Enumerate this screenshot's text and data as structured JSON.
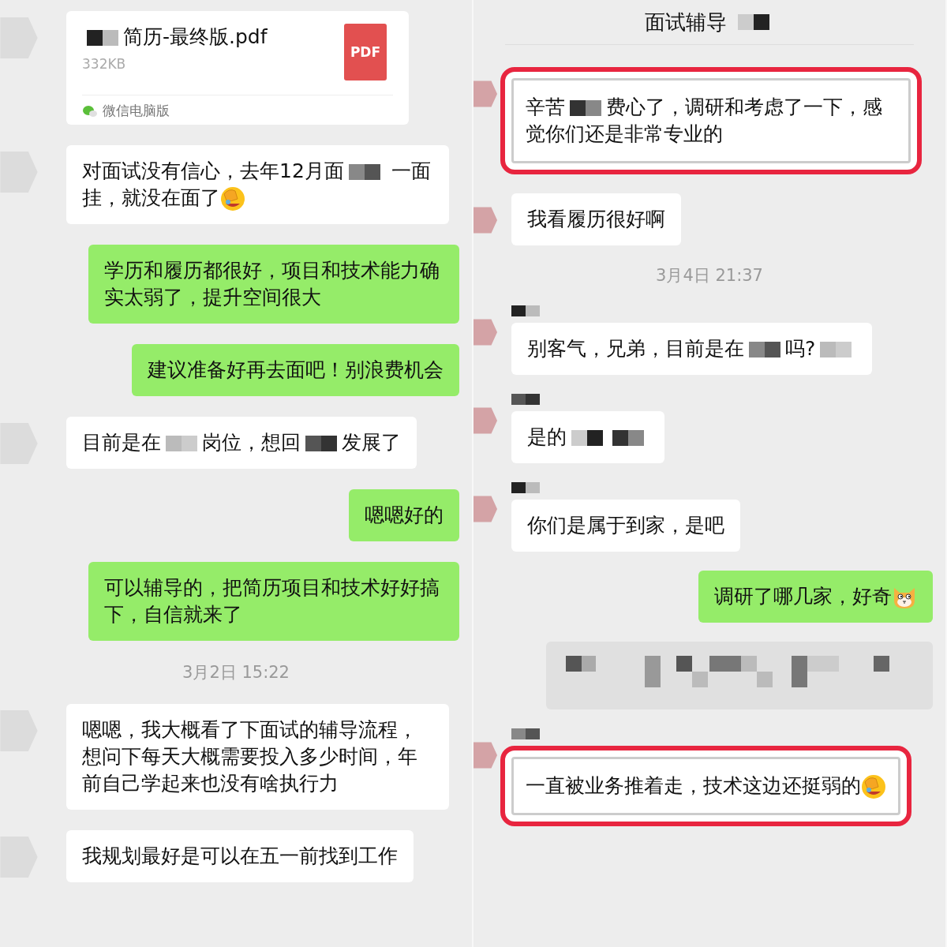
{
  "panels": [
    {
      "messages": [
        {
          "kind": "file",
          "filename": [
            {
              "kind": "mosaic"
            },
            {
              "kind": "text",
              "text": "简历-最终版.pdf"
            }
          ],
          "size": "332KB",
          "file_type": "PDF",
          "source": "微信电脑版"
        },
        {
          "kind": "received",
          "highlighted": false,
          "segments": [
            {
              "kind": "text",
              "text": "对面试没有信心，去年12月面"
            },
            {
              "kind": "mosaic"
            },
            {
              "kind": "text",
              "text": " 一面挂，就没在面了"
            },
            {
              "kind": "facepalm"
            }
          ]
        },
        {
          "kind": "sent",
          "segments": [
            {
              "kind": "text",
              "text": "学历和履历都很好，项目和技术能力确实太弱了，提升空间很大"
            }
          ]
        },
        {
          "kind": "sent",
          "segments": [
            {
              "kind": "text",
              "text": "建议准备好再去面吧！别浪费机会"
            }
          ]
        },
        {
          "kind": "received",
          "highlighted": false,
          "segments": [
            {
              "kind": "text",
              "text": "目前是在"
            },
            {
              "kind": "mosaic"
            },
            {
              "kind": "text",
              "text": "岗位，想回"
            },
            {
              "kind": "mosaic"
            },
            {
              "kind": "text",
              "text": "发展了"
            }
          ]
        },
        {
          "kind": "sent",
          "segments": [
            {
              "kind": "text",
              "text": "嗯嗯好的"
            }
          ]
        },
        {
          "kind": "sent",
          "segments": [
            {
              "kind": "text",
              "text": "可以辅导的，把简历项目和技术好好搞下，自信就来了"
            }
          ]
        },
        {
          "kind": "time",
          "text": "3月2日 15:22"
        },
        {
          "kind": "received",
          "highlighted": false,
          "segments": [
            {
              "kind": "text",
              "text": "嗯嗯，我大概看了下面试的辅导流程，想问下每天大概需要投入多少时间，年前自己学起来也没有啥执行力"
            }
          ]
        },
        {
          "kind": "received",
          "highlighted": false,
          "segments": [
            {
              "kind": "text",
              "text": "我规划最好是可以在五一前找到工作"
            }
          ]
        }
      ]
    },
    {
      "title": [
        {
          "kind": "text",
          "text": "面试辅导"
        },
        {
          "kind": "mosaic"
        }
      ],
      "messages": [
        {
          "kind": "received",
          "highlighted": true,
          "segments": [
            {
              "kind": "text",
              "text": "辛苦"
            },
            {
              "kind": "mosaic"
            },
            {
              "kind": "text",
              "text": "费心了，调研和考虑了一下，感觉你们还是非常专业的"
            }
          ]
        },
        {
          "kind": "received",
          "highlighted": false,
          "segments": [
            {
              "kind": "text",
              "text": "我看履历很好啊"
            }
          ]
        },
        {
          "kind": "time",
          "text": "3月4日 21:37"
        },
        {
          "kind": "received",
          "highlighted": false,
          "sender": [
            {
              "kind": "mosaic"
            }
          ],
          "segments": [
            {
              "kind": "text",
              "text": "别客气，兄弟，目前是在"
            },
            {
              "kind": "mosaic"
            },
            {
              "kind": "text",
              "text": "吗?"
            },
            {
              "kind": "mosaic"
            }
          ]
        },
        {
          "kind": "received",
          "highlighted": false,
          "sender": [
            {
              "kind": "mosaic"
            }
          ],
          "segments": [
            {
              "kind": "text",
              "text": "是的"
            },
            {
              "kind": "mosaic"
            },
            {
              "kind": "mosaic"
            }
          ]
        },
        {
          "kind": "received",
          "highlighted": false,
          "sender": [
            {
              "kind": "mosaic"
            }
          ],
          "segments": [
            {
              "kind": "text",
              "text": "你们是属于到家，是吧"
            }
          ]
        },
        {
          "kind": "sent",
          "segments": [
            {
              "kind": "text",
              "text": "调研了哪几家，好奇"
            },
            {
              "kind": "doge"
            }
          ]
        },
        {
          "kind": "quote"
        },
        {
          "kind": "received",
          "highlighted": true,
          "sender": [
            {
              "kind": "mosaic"
            }
          ],
          "segments": [
            {
              "kind": "text",
              "text": "一直被业务推着走，技术这边还挺弱的"
            },
            {
              "kind": "facepalm"
            }
          ]
        }
      ]
    }
  ]
}
